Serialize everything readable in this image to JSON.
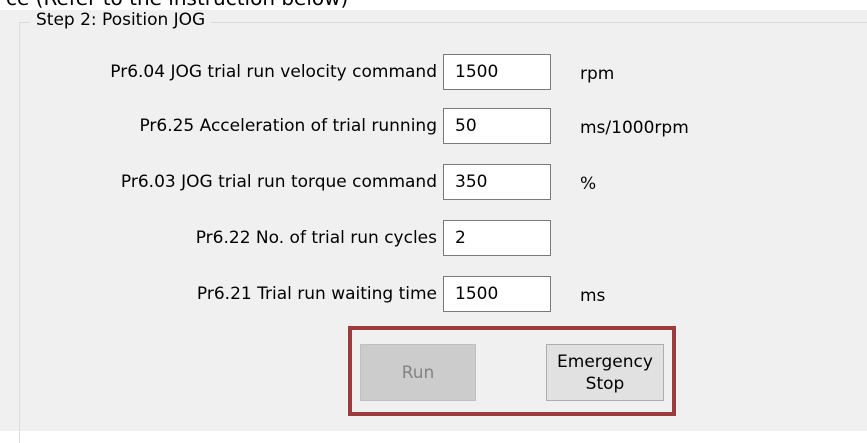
{
  "header_cut_text": "ce (Refer to the instruction below)",
  "group": {
    "title": "Step 2: Position JOG"
  },
  "params": [
    {
      "label": "Pr6.04 JOG trial run velocity command",
      "value": "1500",
      "unit": "rpm"
    },
    {
      "label": "Pr6.25 Acceleration of trial running",
      "value": "50",
      "unit": "ms/1000rpm"
    },
    {
      "label": "Pr6.03 JOG trial run torque command",
      "value": "350",
      "unit": "%"
    },
    {
      "label": "Pr6.22 No. of trial run cycles",
      "value": "2",
      "unit": ""
    },
    {
      "label": "Pr6.21 Trial run waiting time",
      "value": "1500",
      "unit": "ms"
    }
  ],
  "buttons": {
    "run": {
      "label": "Run",
      "enabled": false
    },
    "emergency_stop": {
      "line1": "Emergency",
      "line2": "Stop"
    }
  },
  "colors": {
    "highlight_border": "#9b3b3b",
    "dialog_bg": "#f0f0f0"
  }
}
